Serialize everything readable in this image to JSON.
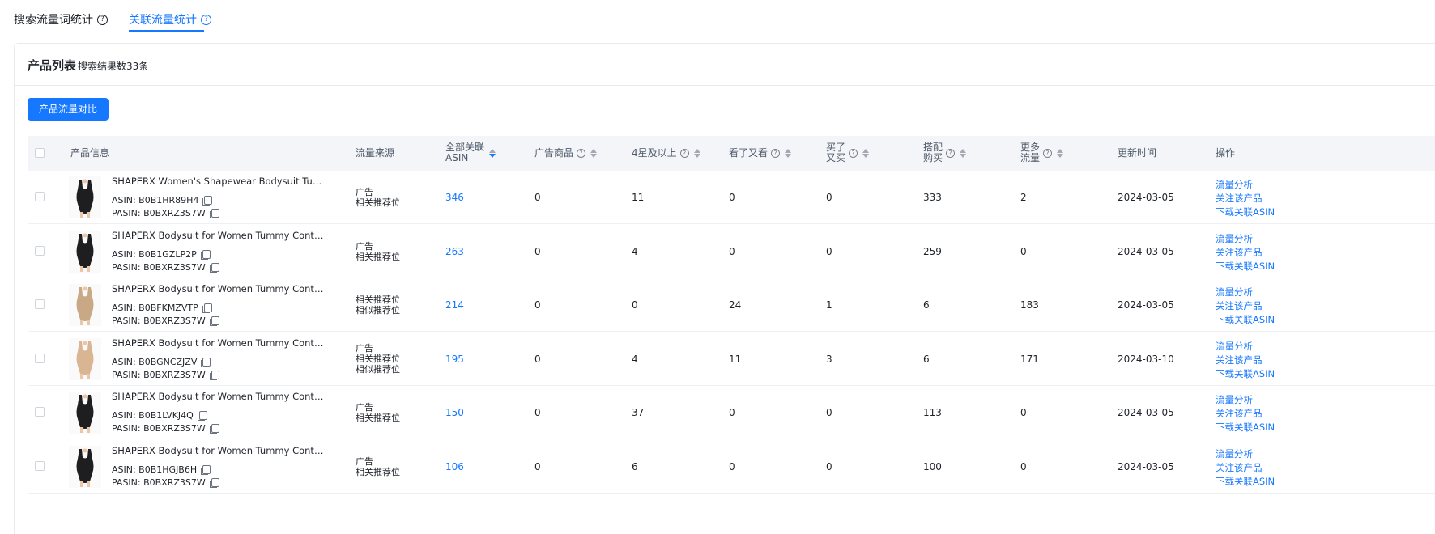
{
  "tabs": [
    {
      "label": "搜索流量词统计",
      "active": false
    },
    {
      "label": "关联流量统计",
      "active": true
    }
  ],
  "card": {
    "title": "产品列表",
    "subtitle": "搜索结果数33条",
    "compare_button": "产品流量对比"
  },
  "columns": {
    "product": "产品信息",
    "source": "流量来源",
    "all_asin": [
      "全部关联",
      "ASIN"
    ],
    "ad": "广告商品",
    "four_star": "4星及以上",
    "viewed": "看了又看",
    "bought": [
      "买了",
      "又买"
    ],
    "bundle": [
      "搭配",
      "购买"
    ],
    "more": [
      "更多",
      "流量"
    ],
    "updated": "更新时间",
    "actions": "操作"
  },
  "colors": {
    "accent": "#1677ff"
  },
  "rows": [
    {
      "title": "SHAPERX Women's Shapewear Bodysuit Tummy Control Shapewear",
      "asin": "ASIN: B0B1HR89H4",
      "pasin": "PASIN: B0BXRZ3S7W",
      "source": [
        "广告",
        "相关推荐位"
      ],
      "all": "346",
      "ad": "0",
      "four": "11",
      "viewed": "0",
      "bought": "0",
      "bundle": "333",
      "more": "2",
      "date": "2024-03-05",
      "swatch": "#1e1e20"
    },
    {
      "title": "SHAPERX Bodysuit for Women Tummy Control Shapewear",
      "asin": "ASIN: B0B1GZLP2P",
      "pasin": "PASIN: B0BXRZ3S7W",
      "source": [
        "广告",
        "相关推荐位"
      ],
      "all": "263",
      "ad": "0",
      "four": "4",
      "viewed": "0",
      "bought": "0",
      "bundle": "259",
      "more": "0",
      "date": "2024-03-05",
      "swatch": "#1e1e20"
    },
    {
      "title": "SHAPERX Bodysuit for Women Tummy Control Shapewear",
      "asin": "ASIN: B0BFKMZVTP",
      "pasin": "PASIN: B0BXRZ3S7W",
      "source": [
        "相关推荐位",
        "相似推荐位"
      ],
      "all": "214",
      "ad": "0",
      "four": "0",
      "viewed": "24",
      "bought": "1",
      "bundle": "6",
      "more": "183",
      "date": "2024-03-05",
      "swatch": "#c9a886"
    },
    {
      "title": "SHAPERX Bodysuit for Women Tummy Control Shapewear",
      "asin": "ASIN: B0BGNCZJZV",
      "pasin": "PASIN: B0BXRZ3S7W",
      "source": [
        "广告",
        "相关推荐位",
        "相似推荐位"
      ],
      "all": "195",
      "ad": "0",
      "four": "4",
      "viewed": "11",
      "bought": "3",
      "bundle": "6",
      "more": "171",
      "date": "2024-03-10",
      "swatch": "#d9b594"
    },
    {
      "title": "SHAPERX Bodysuit for Women Tummy Control Shapewear",
      "asin": "ASIN: B0B1LVKJ4Q",
      "pasin": "PASIN: B0BXRZ3S7W",
      "source": [
        "广告",
        "相关推荐位"
      ],
      "all": "150",
      "ad": "0",
      "four": "37",
      "viewed": "0",
      "bought": "0",
      "bundle": "113",
      "more": "0",
      "date": "2024-03-05",
      "swatch": "#1e1e20"
    },
    {
      "title": "SHAPERX Bodysuit for Women Tummy Control Shapewear",
      "asin": "ASIN: B0B1HGJB6H",
      "pasin": "PASIN: B0BXRZ3S7W",
      "source": [
        "广告",
        "相关推荐位"
      ],
      "all": "106",
      "ad": "0",
      "four": "6",
      "viewed": "0",
      "bought": "0",
      "bundle": "100",
      "more": "0",
      "date": "2024-03-05",
      "swatch": "#1e1e20"
    }
  ],
  "actions": [
    "流量分析",
    "关注该产品",
    "下载关联ASIN"
  ]
}
